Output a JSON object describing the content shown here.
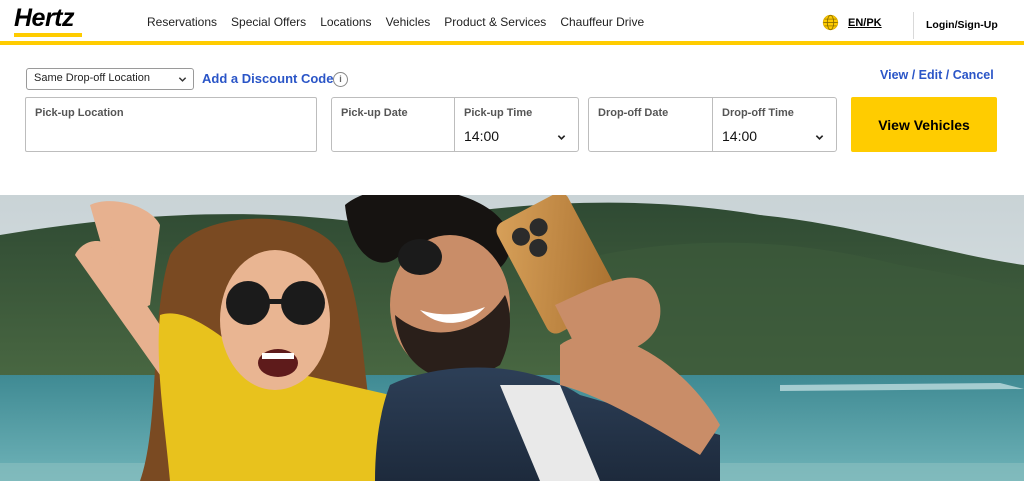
{
  "header": {
    "logo": "Hertz",
    "nav": [
      "Reservations",
      "Special Offers",
      "Locations",
      "Vehicles",
      "Product & Services",
      "Chauffeur Drive"
    ],
    "language": "EN/PK",
    "login": "Login/Sign-Up"
  },
  "booking": {
    "dropoff_option": "Same Drop-off Location",
    "discount_link": "Add a Discount Code",
    "manage_link": "View / Edit / Cancel",
    "pickup_location_label": "Pick-up Location",
    "pickup_date_label": "Pick-up Date",
    "pickup_time_label": "Pick-up Time",
    "pickup_time_value": "14:00",
    "dropoff_date_label": "Drop-off Date",
    "dropoff_time_label": "Drop-off Time",
    "dropoff_time_value": "14:00",
    "submit_label": "View Vehicles"
  },
  "icons": {
    "globe": "globe-icon",
    "info": "info-icon",
    "caret": "chevron-down-icon"
  },
  "colors": {
    "brand_yellow": "#ffcc00",
    "link_blue": "#2a55c7"
  }
}
